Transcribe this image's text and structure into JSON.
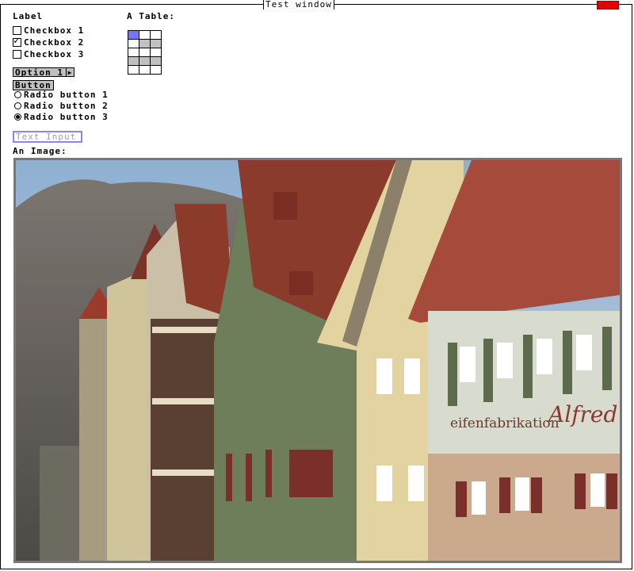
{
  "window": {
    "title": "Test window"
  },
  "label": "Label",
  "checkboxes": [
    {
      "label": "Checkbox 1",
      "checked": false
    },
    {
      "label": "Checkbox 2",
      "checked": true
    },
    {
      "label": "Checkbox 3",
      "checked": false
    }
  ],
  "option": {
    "value": "Option 1"
  },
  "button": {
    "label": "Button"
  },
  "radios": [
    {
      "label": "Radio button 1",
      "selected": false
    },
    {
      "label": "Radio button 2",
      "selected": false
    },
    {
      "label": "Radio button 3",
      "selected": true
    }
  ],
  "text_input": {
    "placeholder": "Text Input",
    "value": ""
  },
  "image": {
    "label": "An Image:",
    "shop_sign_left": "eifenfabrikation",
    "shop_sign_right": "Alfred"
  },
  "table": {
    "label": "A Table:"
  },
  "colors": {
    "close": "#e00000",
    "input_border": "#8888ee",
    "table_selected": "#7777ee",
    "table_shade": "#c0c0c0",
    "button_bg": "#c0c0c0"
  }
}
